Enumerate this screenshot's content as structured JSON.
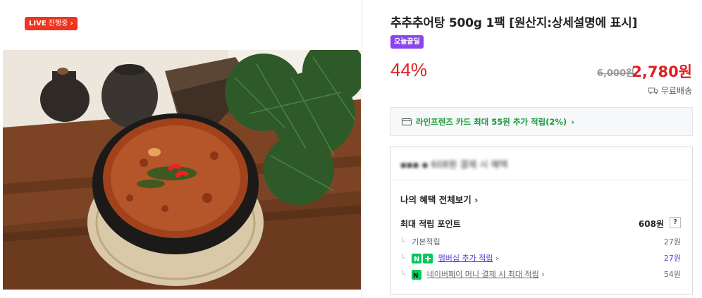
{
  "live_badge": {
    "label": "LIVE",
    "status": "진행중"
  },
  "product": {
    "title": "추추추어탕 500g 1팩 [원산지:상세설명에 표시]",
    "deal_badge": "오늘끝딜",
    "discount": "44%",
    "original_price": "6,000원",
    "sale_price": "2,780원",
    "shipping": "무료배송"
  },
  "card_promo": {
    "text": "라인프렌즈 카드 최대 55원 추가 적립(2%)"
  },
  "benefits": {
    "blur_heading": "▪▪▪ ▪ 608원 결제 시 혜택",
    "all_label": "나의 혜택 전체보기",
    "max_label": "최대 적립 포인트",
    "max_value": "608원",
    "help": "?",
    "rows": [
      {
        "label": "기본적립",
        "value": "27원"
      },
      {
        "label": "멤버십 추가 적립",
        "value": "27원"
      },
      {
        "label": "네이버페이 머니 결제 시 최대 적립",
        "value": "54원"
      }
    ]
  },
  "colors": {
    "accent_red": "#e02020",
    "live_red": "#f0341f",
    "deal_purple": "#8a43ee",
    "card_green": "#1a9c3a",
    "naver_green": "#03c75a"
  }
}
